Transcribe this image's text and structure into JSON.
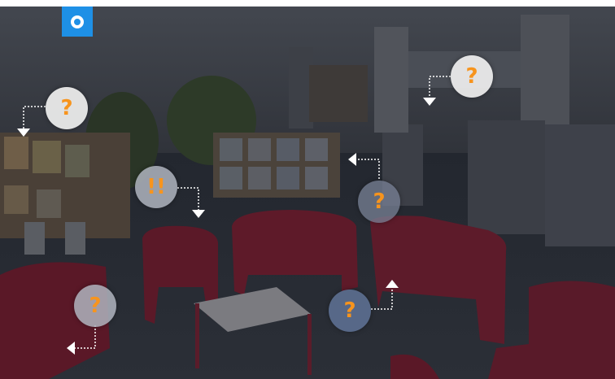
{
  "page": {
    "logo_icon": "circle-logo-icon",
    "accent_color": "#1e90e6",
    "hotspot_symbol_color": "#f7941d"
  },
  "hotspots": [
    {
      "name": "hotspot-top-left",
      "label": "?"
    },
    {
      "name": "hotspot-top-right",
      "label": "?"
    },
    {
      "name": "hotspot-middle-left",
      "label": "!!"
    },
    {
      "name": "hotspot-middle-right",
      "label": "?"
    },
    {
      "name": "hotspot-bottom-left",
      "label": "?"
    },
    {
      "name": "hotspot-bottom-center",
      "label": "?"
    }
  ]
}
